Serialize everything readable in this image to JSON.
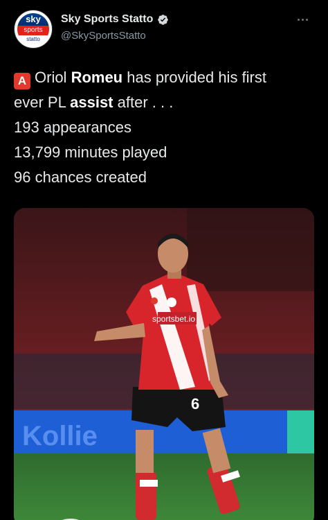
{
  "account": {
    "display_name": "Sky Sports Statto",
    "handle": "@SkySportsStatto",
    "verified": true,
    "avatar": {
      "line1": "sky",
      "line2": "sports",
      "line3": "statto"
    }
  },
  "tweet": {
    "badge": "A",
    "line1_pre": "Oriol ",
    "line1_bold": "Romeu",
    "line1_post": " has provided his first",
    "line2_pre": "ever PL ",
    "line2_bold": "assist",
    "line2_post": " after . . .",
    "line3": "193 appearances",
    "line4": "13,799 minutes played",
    "line5": "96 chances created"
  },
  "media": {
    "shirt_sponsor": "sportsbet.io",
    "shirt_number": "6",
    "board_text": "Kollie"
  },
  "colors": {
    "background": "#000000",
    "text": "#e7e9ea",
    "secondary_text": "#8b98a5",
    "verified": "#8b98a5",
    "badge": "#e1392e"
  },
  "icons": {
    "verified": "verified-badge-icon",
    "more": "more-options-icon"
  }
}
